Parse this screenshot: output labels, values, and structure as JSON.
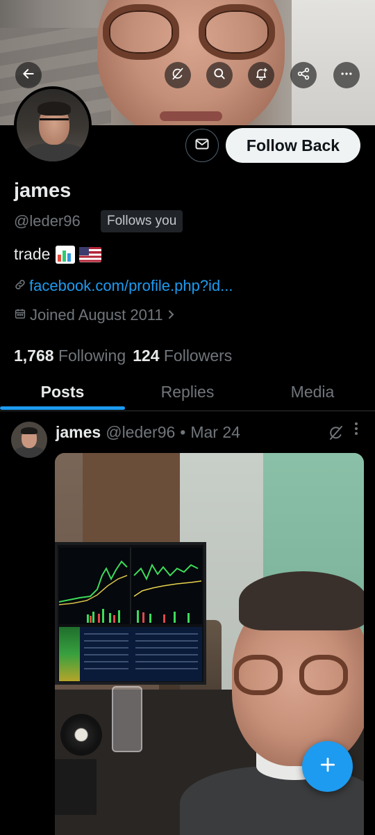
{
  "header": {
    "icons": [
      "back-arrow-icon",
      "grok-icon",
      "search-icon",
      "notification-bell-plus-icon",
      "share-icon",
      "more-icon"
    ]
  },
  "profile": {
    "name": "james",
    "handle": "@leder96",
    "follows_you": "Follows you",
    "bio_text": "trade",
    "bio_emojis": [
      "chart-emoji",
      "us-flag-emoji"
    ],
    "link": "facebook.com/profile.php?id...",
    "joined": "Joined August 2011",
    "follow_button": "Follow Back",
    "following_count": "1,768",
    "following_label": "Following",
    "followers_count": "124",
    "followers_label": "Followers"
  },
  "tabs": [
    {
      "label": "Posts",
      "active": true
    },
    {
      "label": "Replies",
      "active": false
    },
    {
      "label": "Media",
      "active": false
    }
  ],
  "post": {
    "name": "james",
    "handle": "@leder96",
    "separator": "•",
    "date": "Mar 24"
  },
  "colors": {
    "accent": "#1d9bf0",
    "background": "#000000",
    "secondary_text": "#71767b"
  }
}
